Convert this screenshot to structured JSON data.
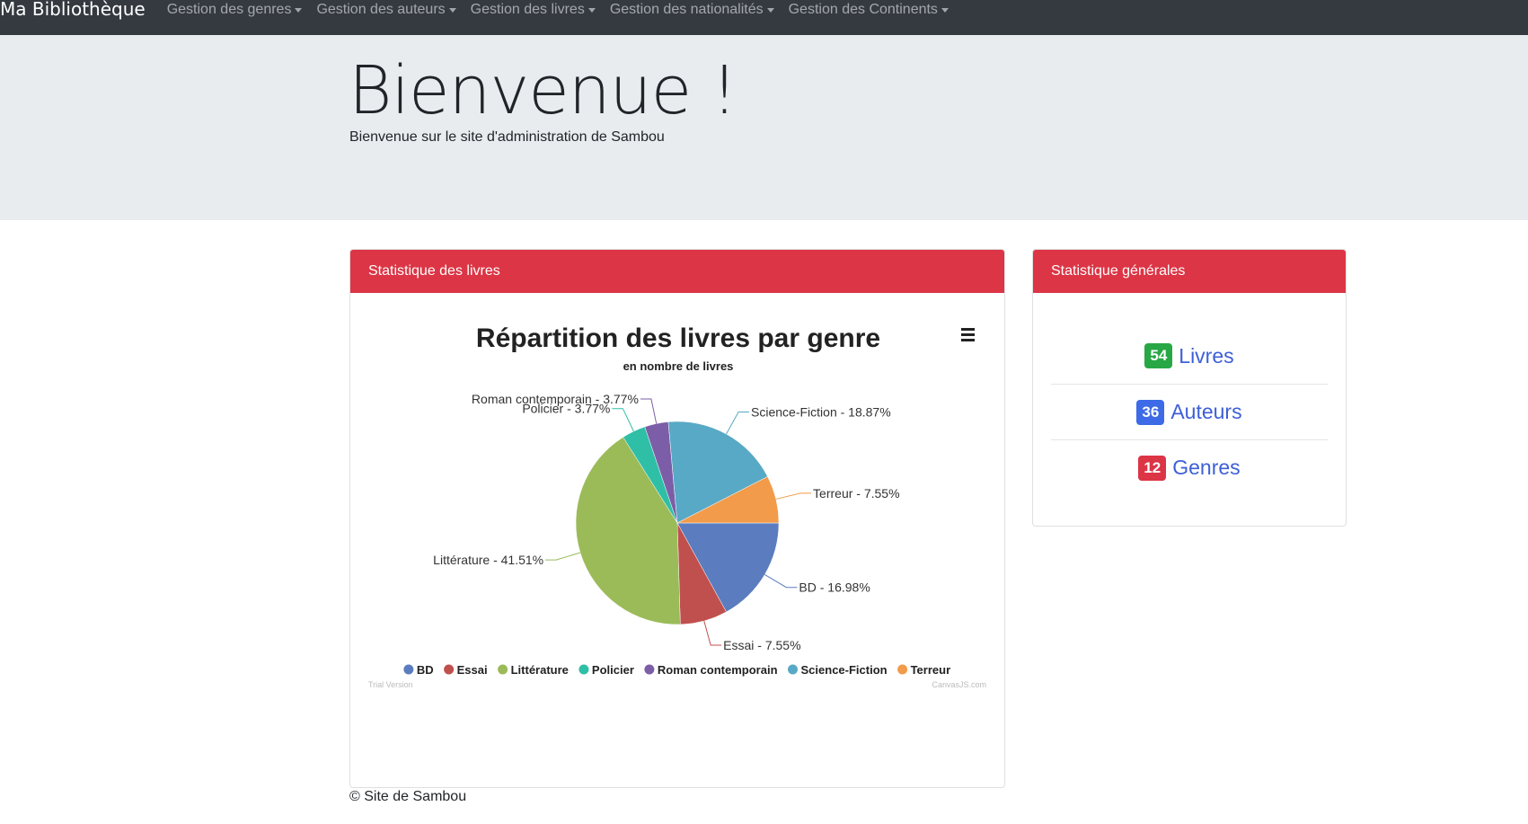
{
  "navbar": {
    "brand": "Ma Bibliothèque",
    "items": [
      {
        "label": "Gestion des genres"
      },
      {
        "label": "Gestion des auteurs"
      },
      {
        "label": "Gestion des livres"
      },
      {
        "label": "Gestion des nationalités"
      },
      {
        "label": "Gestion des Continents"
      }
    ]
  },
  "jumbotron": {
    "title": "Bienvenue !",
    "text": "Bienvenue sur le site d'administration de Sambou"
  },
  "books_card": {
    "header": "Statistique des livres",
    "watermark_left": "Trial Version",
    "watermark_right": "CanvasJS.com"
  },
  "stats_card": {
    "header": "Statistique générales",
    "items": [
      {
        "count": "54",
        "label": "Livres",
        "color": "#28a745"
      },
      {
        "count": "36",
        "label": "Auteurs",
        "color": "#3d6ae6"
      },
      {
        "count": "12",
        "label": "Genres",
        "color": "#dc3545"
      }
    ]
  },
  "chart_data": {
    "type": "pie",
    "title": "Répartition des livres par genre",
    "subtitle": "en nombre de livres",
    "slices": [
      {
        "name": "BD",
        "value": 16.98,
        "label": "BD - 16.98%",
        "color": "#5b7dbf"
      },
      {
        "name": "Essai",
        "value": 7.55,
        "label": "Essai - 7.55%",
        "color": "#c0504d"
      },
      {
        "name": "Littérature",
        "value": 41.51,
        "label": "Littérature - 41.51%",
        "color": "#9bbb59"
      },
      {
        "name": "Policier",
        "value": 3.77,
        "label": "Policier - 3.77%",
        "color": "#2fbfa6"
      },
      {
        "name": "Roman contemporain",
        "value": 3.77,
        "label": "Roman contemporain - 3.77%",
        "color": "#7b5ea7"
      },
      {
        "name": "Science-Fiction",
        "value": 18.87,
        "label": "Science-Fiction - 18.87%",
        "color": "#58a9c5"
      },
      {
        "name": "Terreur",
        "value": 7.55,
        "label": "Terreur - 7.55%",
        "color": "#f29b4a"
      }
    ],
    "legend_placement": "bottom"
  },
  "footer": {
    "text": "© Site de Sambou"
  }
}
